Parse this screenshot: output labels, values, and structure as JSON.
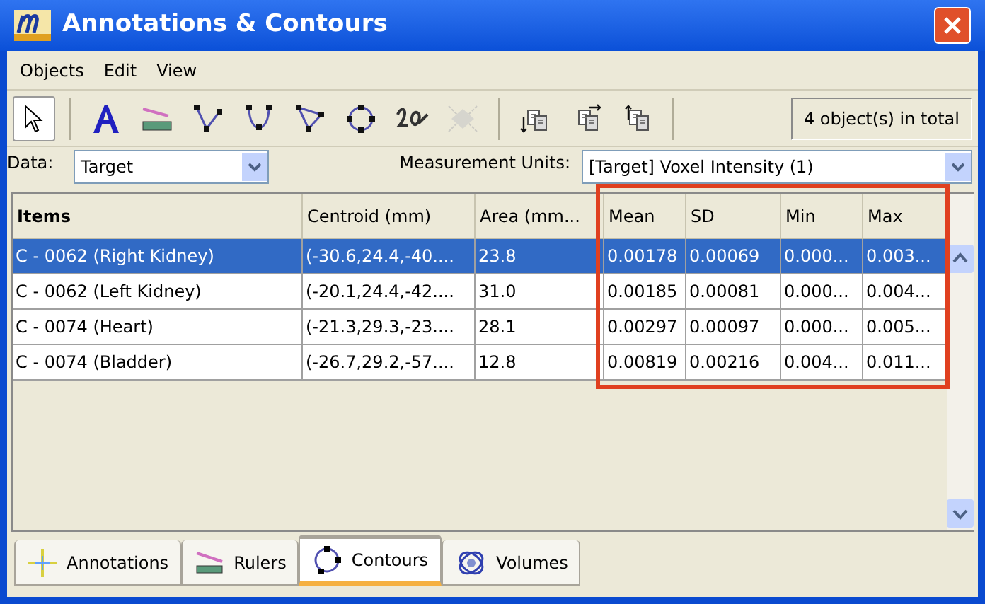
{
  "window": {
    "title": "Annotations & Contours"
  },
  "menu": [
    "Objects",
    "Edit",
    "View"
  ],
  "toolbar": {
    "tools": [
      {
        "kind": "pointer",
        "selected": true,
        "disabled": false
      },
      {
        "kind": "text",
        "selected": false,
        "disabled": false
      },
      {
        "kind": "ruler",
        "selected": false,
        "disabled": false
      },
      {
        "kind": "vshape",
        "selected": false,
        "disabled": false
      },
      {
        "kind": "ushape",
        "selected": false,
        "disabled": false
      },
      {
        "kind": "triangle",
        "selected": false,
        "disabled": false
      },
      {
        "kind": "circle",
        "selected": false,
        "disabled": false
      },
      {
        "kind": "freehand",
        "selected": false,
        "disabled": false
      },
      {
        "kind": "nodes",
        "selected": false,
        "disabled": true
      },
      {
        "kind": "copy-down",
        "selected": false,
        "disabled": false
      },
      {
        "kind": "copy-right",
        "selected": false,
        "disabled": false
      },
      {
        "kind": "copy-up",
        "selected": false,
        "disabled": false
      }
    ],
    "count": "4 object(s) in total"
  },
  "data": {
    "label": "Data:",
    "value": "Target"
  },
  "units": {
    "label": "Measurement Units:",
    "value": "[Target] Voxel Intensity (1)"
  },
  "table": {
    "columns": [
      "Items",
      "Centroid (mm)",
      "Area (mm...",
      "Mean",
      "SD",
      "Min",
      "Max"
    ],
    "rows": [
      {
        "cells": [
          "C - 0062 (Right Kidney)",
          "(-30.6,24.4,-40....",
          "23.8",
          "0.00178",
          "0.00069",
          "0.000...",
          "0.003..."
        ],
        "selected": true
      },
      {
        "cells": [
          "C - 0062 (Left Kidney)",
          "(-20.1,24.4,-42....",
          "31.0",
          "0.00185",
          "0.00081",
          "0.000...",
          "0.004..."
        ],
        "selected": false
      },
      {
        "cells": [
          "C - 0074 (Heart)",
          "(-21.3,29.3,-23....",
          "28.1",
          "0.00297",
          "0.00097",
          "0.000...",
          "0.005..."
        ],
        "selected": false
      },
      {
        "cells": [
          "C - 0074 (Bladder)",
          "(-26.7,29.2,-57....",
          "12.8",
          "0.00819",
          "0.00216",
          "0.004...",
          "0.011..."
        ],
        "selected": false
      }
    ]
  },
  "tabs": [
    {
      "label": "Annotations",
      "kind": "annotations",
      "selected": false
    },
    {
      "label": "Rulers",
      "kind": "rulers",
      "selected": false
    },
    {
      "label": "Contours",
      "kind": "contours",
      "selected": true
    },
    {
      "label": "Volumes",
      "kind": "volumes",
      "selected": false
    }
  ]
}
